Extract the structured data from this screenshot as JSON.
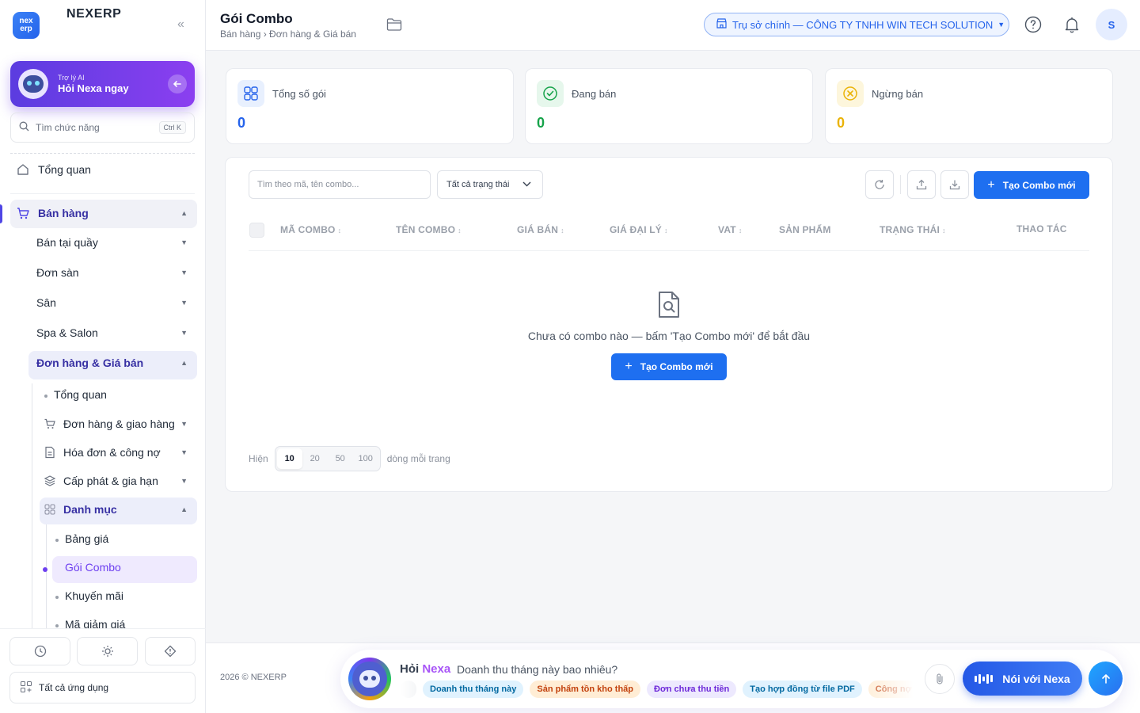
{
  "brand": {
    "logo_text": "nex erp",
    "name": "NEXERP",
    "collapse": "«"
  },
  "ai_card": {
    "subtitle": "Trợ lý AI",
    "title": "Hỏi Nexa ngay"
  },
  "side_search": {
    "placeholder": "Tìm chức năng",
    "shortcut": "Ctrl K"
  },
  "nav": {
    "overview": "Tổng quan",
    "sales": "Bán hàng",
    "pos": "Bán tại quầy",
    "marketplace": "Đơn sàn",
    "court": "Sân",
    "spa": "Spa & Salon",
    "orders_prices": "Đơn hàng & Giá bán",
    "sub_overview": "Tổng quan",
    "orders_delivery": "Đơn hàng & giao hàng",
    "invoices_debt": "Hóa đơn & công nợ",
    "provision_renewal": "Cấp phát & gia hạn",
    "catalog": "Danh mục",
    "price_list": "Bảng giá",
    "combo": "Gói Combo",
    "promotions": "Khuyến mãi",
    "discount_codes": "Mã giảm giá"
  },
  "all_apps": "Tất cả ứng dụng",
  "header": {
    "title": "Gói Combo",
    "breadcrumb": "Bán hàng › Đơn hàng & Giá bán",
    "org": "Trụ sở chính — CÔNG TY TNHH WIN TECH SOLUTION",
    "avatar_initial": "S"
  },
  "stats": [
    {
      "label": "Tổng số gói",
      "value": "0",
      "color": "#2563eb"
    },
    {
      "label": "Đang bán",
      "value": "0",
      "color": "#16a34a"
    },
    {
      "label": "Ngừng bán",
      "value": "0",
      "color": "#eab308"
    }
  ],
  "toolbar": {
    "search_placeholder": "Tìm theo mã, tên combo...",
    "status_filter": "Tất cả trạng thái",
    "create_label": "Tạo Combo mới"
  },
  "table": {
    "columns": [
      "MÃ COMBO",
      "TÊN COMBO",
      "GIÁ BÁN",
      "GIÁ ĐẠI LÝ",
      "VAT",
      "SẢN PHẨM",
      "TRẠNG THÁI",
      "THAO TÁC"
    ],
    "empty_text": "Chưa có combo nào — bấm 'Tạo Combo mới' để bắt đầu",
    "empty_cta": "Tạo Combo mới"
  },
  "pager": {
    "prefix": "Hiện",
    "options": [
      "10",
      "20",
      "50",
      "100"
    ],
    "selected": "10",
    "suffix": "dòng mỗi trang"
  },
  "footer": {
    "copyright": "2026 © NEXERP",
    "ask": "Hỏi",
    "nexa": "Nexa",
    "question": "Doanh thu tháng này bao nhiêu?",
    "chips": [
      "Doanh thu tháng này",
      "Sản phẩm tồn kho thấp",
      "Đơn chưa thu tiền",
      "Tạo hợp đồng từ file PDF",
      "Công nợ quá hạn"
    ],
    "talk_label": "Nói với Nexa"
  },
  "colors": {
    "accent": "#1e6ff0",
    "ai_purple": "#6d3ff0",
    "active_nav": "#3730a3"
  }
}
